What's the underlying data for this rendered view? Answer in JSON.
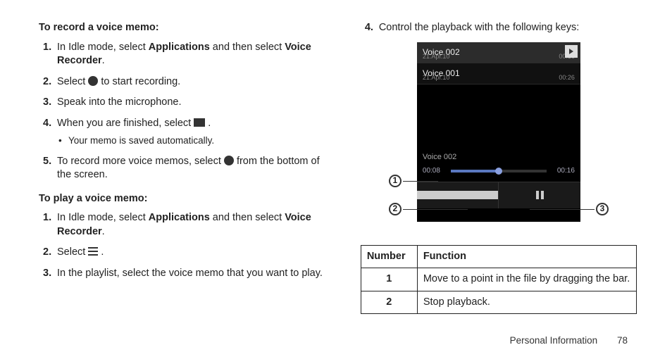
{
  "left": {
    "heading_record": "To record a voice memo:",
    "rec": {
      "1a": "In Idle mode, select ",
      "1b": "Applications",
      "1c": " and then select ",
      "1d": "Voice Recorder",
      "1e": ".",
      "2a": "Select ",
      "2b": " to start recording.",
      "3": "Speak into the microphone.",
      "4a": "When you are finished, select ",
      "4b": " .",
      "4bullet": "Your memo is saved automatically.",
      "5a": "To record more voice memos, select ",
      "5b": " from the bottom of the screen."
    },
    "heading_play": "To play a voice memo:",
    "play": {
      "1a": "In Idle mode, select ",
      "1b": "Applications",
      "1c": " and then select ",
      "1d": "Voice Recorder",
      "1e": ".",
      "2a": "Select ",
      "2b": " .",
      "3": "In the playlist, select the voice memo that you want to play."
    }
  },
  "right": {
    "step4": "Control the playback with the following keys:",
    "phone": {
      "row1_title": "Voice 002",
      "row1_date": "21.Apr.10",
      "row1_dur": "00:16",
      "row2_title": "Voice 001",
      "row2_date": "21.Apr.10",
      "row2_dur": "00:26",
      "now_title": "Voice 002",
      "elapsed": "00:08",
      "total": "00:16"
    },
    "callouts": {
      "c1": "1",
      "c2": "2",
      "c3": "3"
    },
    "table": {
      "h_num": "Number",
      "h_fn": "Function",
      "r1_num": "1",
      "r1_fn": "Move to a point in the file by dragging the bar.",
      "r2_num": "2",
      "r2_fn": "Stop playback."
    }
  },
  "footer": {
    "section": "Personal Information",
    "page": "78"
  }
}
